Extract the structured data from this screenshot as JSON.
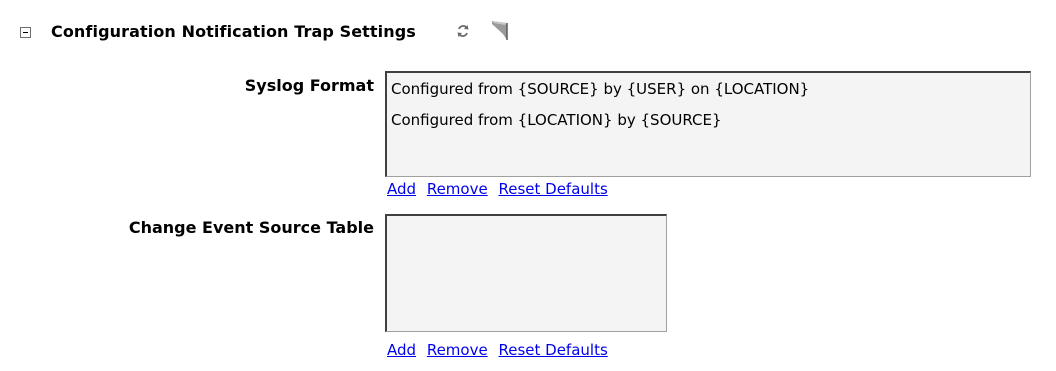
{
  "section": {
    "title": "Configuration Notification Trap Settings",
    "icons": [
      "minus-box-icon",
      "refresh-icon",
      "flag-icon"
    ]
  },
  "syslog_format": {
    "label": "Syslog Format",
    "items": [
      "Configured from {SOURCE} by {USER} on {LOCATION}",
      "Configured from {LOCATION} by {SOURCE}"
    ],
    "links": {
      "add": "Add",
      "remove": "Remove",
      "reset": "Reset Defaults"
    }
  },
  "change_event_source_table": {
    "label": "Change Event Source Table",
    "items": [],
    "links": {
      "add": "Add",
      "remove": "Remove",
      "reset": "Reset Defaults"
    }
  }
}
